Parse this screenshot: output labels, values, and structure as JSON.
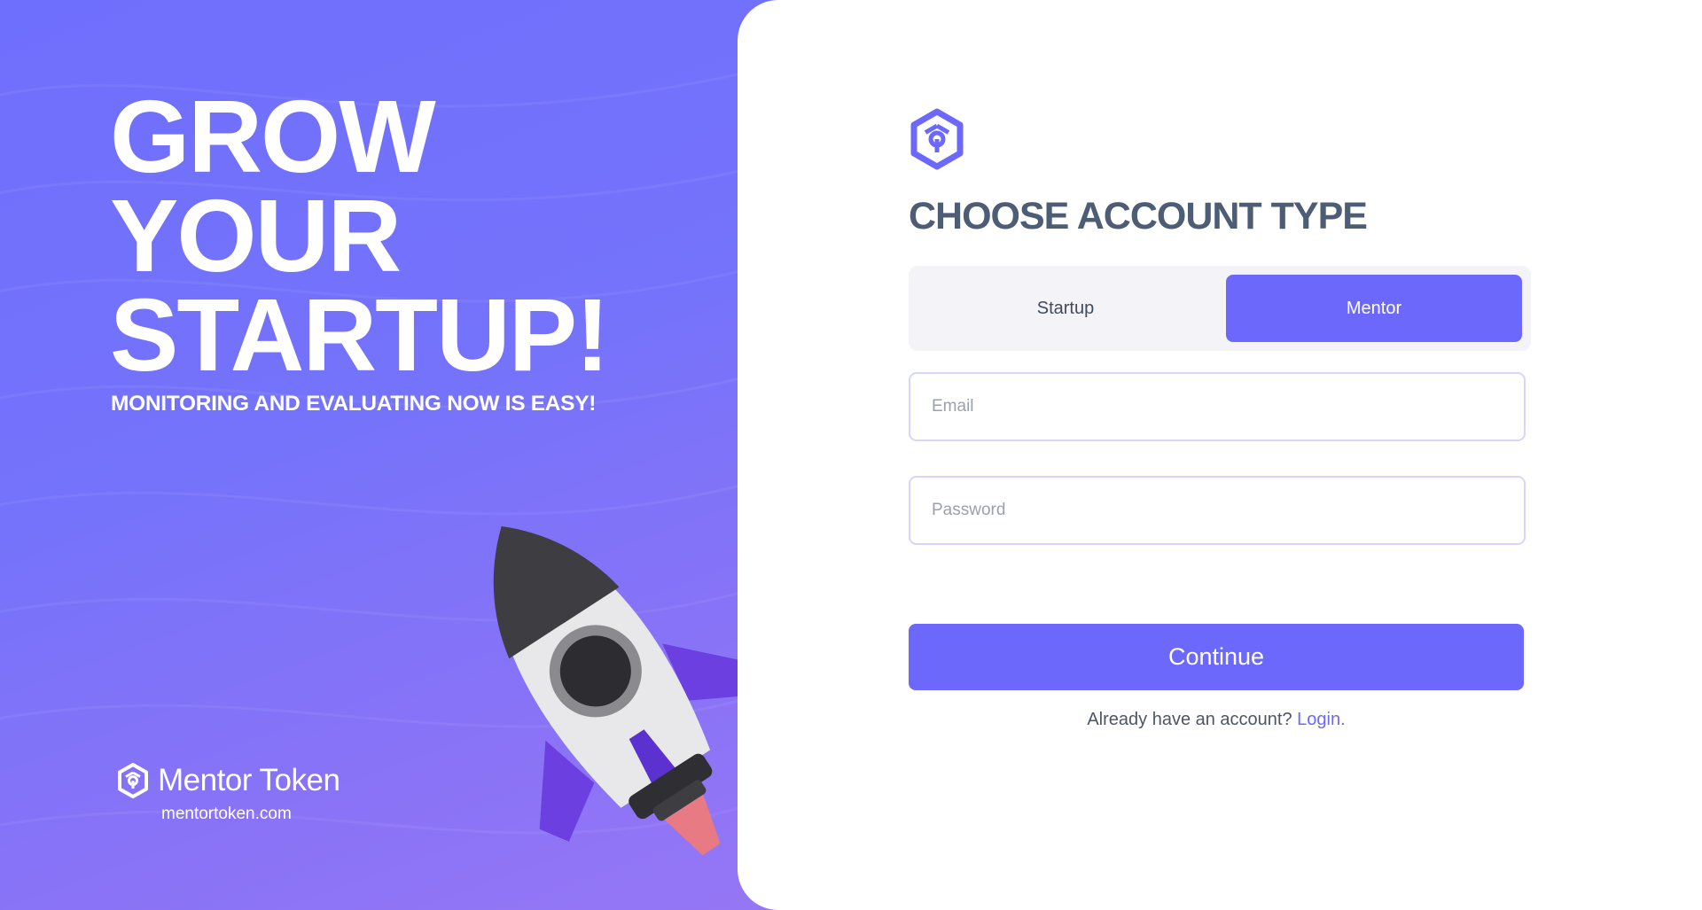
{
  "hero": {
    "title_lines": [
      "GROW",
      "YOUR",
      "STARTUP!"
    ],
    "subtitle": "MONITORING AND EVALUATING NOW IS EASY!",
    "background_colors": [
      "#6f6ffd",
      "#9577f5"
    ]
  },
  "brand": {
    "logo_icon": "hexagon-cube-icon",
    "name": "Mentor Token",
    "url": "mentortoken.com"
  },
  "form": {
    "logo_icon": "hexagon-cube-icon",
    "heading": "CHOOSE ACCOUNT TYPE",
    "tabs": [
      {
        "label": "Startup",
        "active": false
      },
      {
        "label": "Mentor",
        "active": true
      }
    ],
    "email": {
      "placeholder": "Email",
      "value": ""
    },
    "password": {
      "placeholder": "Password",
      "value": ""
    },
    "continue_label": "Continue",
    "login_prompt": "Already have an account?",
    "login_link": "Login."
  },
  "colors": {
    "accent": "#6c68fb",
    "heading": "#4d5d75",
    "input_border": "#d8d5fb",
    "rocket_body": "#e6e6e6",
    "rocket_fins": "#6b3fe0",
    "rocket_flame": "#e77a82"
  }
}
